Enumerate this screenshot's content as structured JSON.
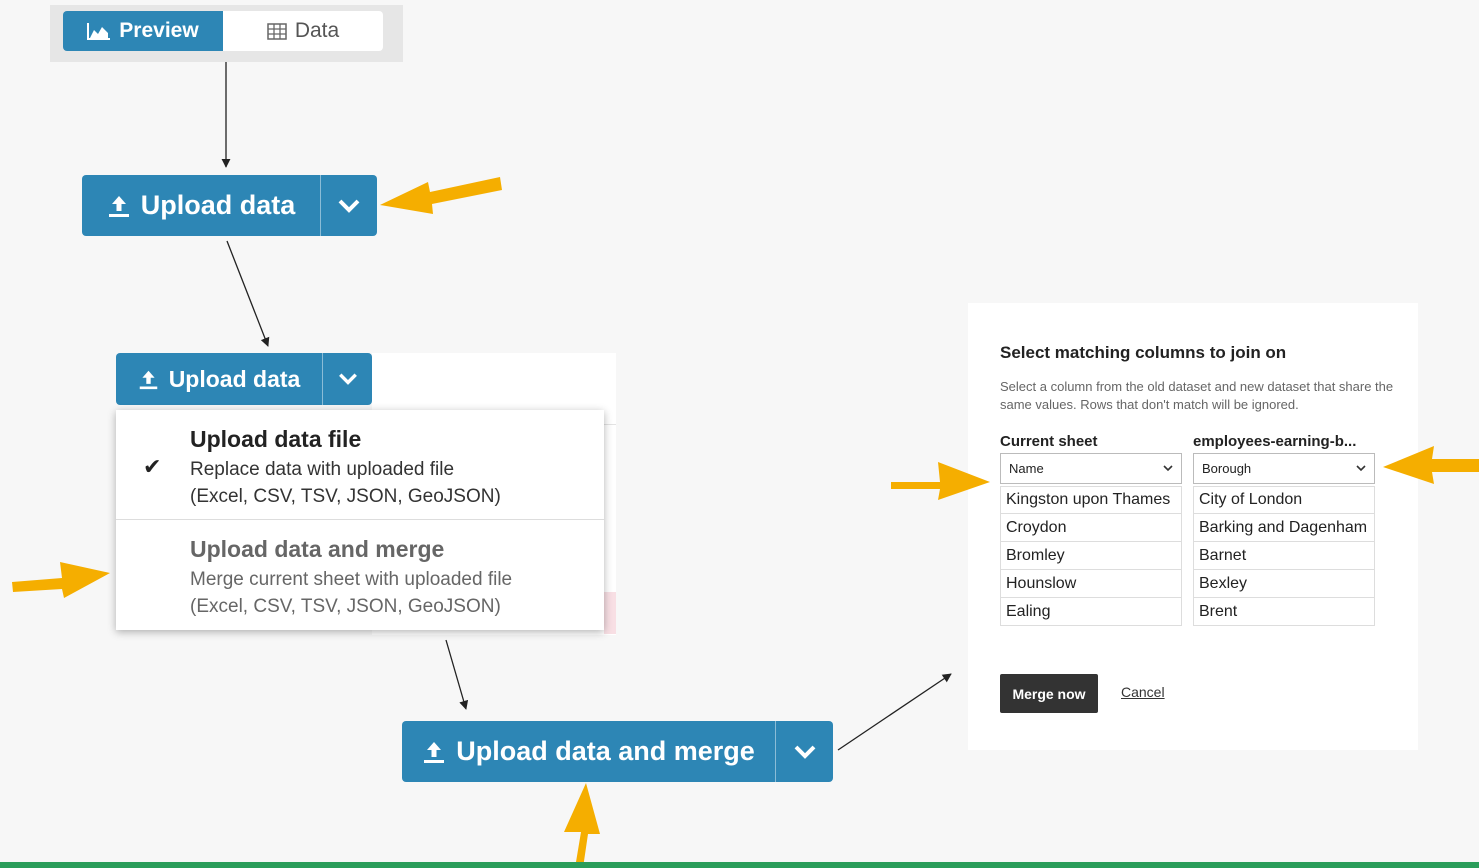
{
  "toggle": {
    "preview_label": "Preview",
    "data_label": "Data",
    "preview_icon": "area-chart-icon",
    "data_icon": "table-icon"
  },
  "upload_button_1": {
    "label": "Upload data",
    "icon": "upload-icon",
    "caret": "chevron-down-icon"
  },
  "upload_button_2": {
    "label": "Upload data",
    "icon": "upload-icon",
    "caret": "chevron-down-icon"
  },
  "dropdown": {
    "items": [
      {
        "title": "Upload data file",
        "desc1": "Replace data with uploaded file",
        "desc2": "(Excel, CSV, TSV, JSON, GeoJSON)",
        "checked": true
      },
      {
        "title": "Upload data and merge",
        "desc1": "Merge current sheet with uploaded file",
        "desc2": "(Excel, CSV, TSV, JSON, GeoJSON)",
        "checked": false
      }
    ]
  },
  "upload_button_3": {
    "label": "Upload data and merge",
    "icon": "upload-icon",
    "caret": "chevron-down-icon"
  },
  "merge_panel": {
    "title": "Select matching columns to join on",
    "description": "Select a column from the old dataset and new dataset that share the same values. Rows that don't match will be ignored.",
    "left_column": {
      "header": "Current sheet",
      "selected": "Name",
      "values": [
        "Kingston upon Thames",
        "Croydon",
        "Bromley",
        "Hounslow",
        "Ealing"
      ]
    },
    "right_column": {
      "header": "employees-earning-b...",
      "selected": "Borough",
      "values": [
        "City of London",
        "Barking and Dagenham",
        "Barnet",
        "Bexley",
        "Brent"
      ]
    },
    "merge_button": "Merge now",
    "cancel_link": "Cancel"
  },
  "colors": {
    "button_blue": "#2d86b5",
    "arrow_orange": "#f5ae00",
    "bottom_bar": "#2a9d5a"
  }
}
